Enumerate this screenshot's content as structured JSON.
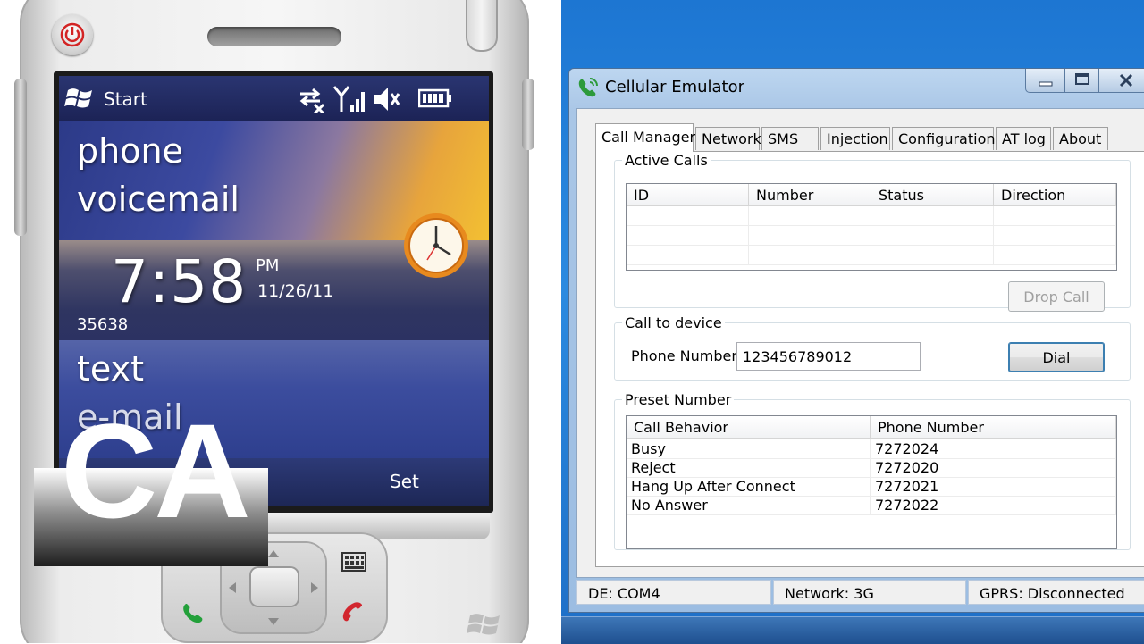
{
  "phone": {
    "status_bar": {
      "start_label": "Start"
    },
    "tiles": {
      "phone_label": "phone",
      "voicemail_label": "voicemail",
      "time": "7:58",
      "ampm": "PM",
      "date": "11/26/11",
      "steps": "35638",
      "text_label": "text",
      "email_label": "e-mail"
    },
    "softkey_right": "Set",
    "overlay_badge": "CA"
  },
  "window": {
    "title": "Cellular Emulator",
    "tabs": [
      {
        "label": "Call Manager",
        "active": true
      },
      {
        "label": "Network",
        "active": false
      },
      {
        "label": "SMS",
        "active": false
      },
      {
        "label": "Injection",
        "active": false
      },
      {
        "label": "Configuration",
        "active": false
      },
      {
        "label": "AT log",
        "active": false
      },
      {
        "label": "About",
        "active": false
      }
    ],
    "active_calls": {
      "legend": "Active Calls",
      "columns": [
        "ID",
        "Number",
        "Status",
        "Direction"
      ],
      "rows": [],
      "drop_button": "Drop Call"
    },
    "call_to_device": {
      "legend": "Call to device",
      "phone_label": "Phone Number:",
      "phone_value": "123456789012",
      "dial_button": "Dial"
    },
    "preset_number": {
      "legend": "Preset Number",
      "columns": [
        "Call Behavior",
        "Phone Number"
      ],
      "rows": [
        [
          "Busy",
          "7272024"
        ],
        [
          "Reject",
          "7272020"
        ],
        [
          "Hang Up After Connect",
          "7272021"
        ],
        [
          "No Answer",
          "7272022"
        ]
      ]
    },
    "status_bar": {
      "port": "DE: COM4",
      "network": "Network: 3G",
      "gprs": "GPRS: Disconnected"
    }
  },
  "colors": {
    "desktop_blue": "#1d76d2",
    "screen_blue": "#334a93",
    "tile_orange": "#f3c032"
  }
}
